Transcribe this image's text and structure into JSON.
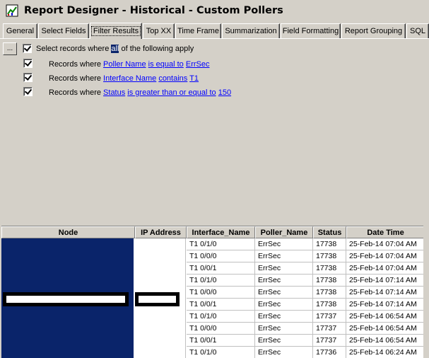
{
  "window": {
    "title": "Report Designer - Historical - Custom Pollers"
  },
  "tabs": [
    {
      "label": "General"
    },
    {
      "label": "Select Fields"
    },
    {
      "label": "Filter Results"
    },
    {
      "label": "Top XX"
    },
    {
      "label": "Time Frame"
    },
    {
      "label": "Summarization"
    },
    {
      "label": "Field Formatting"
    },
    {
      "label": "Report Grouping"
    },
    {
      "label": "SQL"
    }
  ],
  "active_tab": "Filter Results",
  "filter": {
    "more_button": "...",
    "header": {
      "prefix": "Select records where ",
      "quantifier": "all",
      "suffix": " of the following apply",
      "checked": true
    },
    "rules": [
      {
        "prefix": "Records where ",
        "field": "Poller Name",
        "operator": "is equal to",
        "value": "ErrSec",
        "checked": true
      },
      {
        "prefix": "Records where ",
        "field": "Interface Name",
        "operator": "contains",
        "value": "T1",
        "checked": true
      },
      {
        "prefix": "Records where ",
        "field": "Status",
        "operator": "is greater than or equal to",
        "value": "150",
        "checked": true
      }
    ]
  },
  "grid": {
    "columns": [
      "Node",
      "IP Address",
      "Interface_Name",
      "Poller_Name",
      "Status",
      "Date Time"
    ],
    "rows": [
      {
        "interface": "T1 0/1/0",
        "poller": "ErrSec",
        "status": "17738",
        "datetime": "25-Feb-14 07:04 AM"
      },
      {
        "interface": "T1 0/0/0",
        "poller": "ErrSec",
        "status": "17738",
        "datetime": "25-Feb-14 07:04 AM"
      },
      {
        "interface": "T1 0/0/1",
        "poller": "ErrSec",
        "status": "17738",
        "datetime": "25-Feb-14 07:04 AM"
      },
      {
        "interface": "T1 0/1/0",
        "poller": "ErrSec",
        "status": "17738",
        "datetime": "25-Feb-14 07:14 AM"
      },
      {
        "interface": "T1 0/0/0",
        "poller": "ErrSec",
        "status": "17738",
        "datetime": "25-Feb-14 07:14 AM"
      },
      {
        "interface": "T1 0/0/1",
        "poller": "ErrSec",
        "status": "17738",
        "datetime": "25-Feb-14 07:14 AM"
      },
      {
        "interface": "T1 0/1/0",
        "poller": "ErrSec",
        "status": "17737",
        "datetime": "25-Feb-14 06:54 AM"
      },
      {
        "interface": "T1 0/0/0",
        "poller": "ErrSec",
        "status": "17737",
        "datetime": "25-Feb-14 06:54 AM"
      },
      {
        "interface": "T1 0/0/1",
        "poller": "ErrSec",
        "status": "17737",
        "datetime": "25-Feb-14 06:54 AM"
      },
      {
        "interface": "T1 0/1/0",
        "poller": "ErrSec",
        "status": "17736",
        "datetime": "25-Feb-14 06:24 AM"
      }
    ]
  },
  "colors": {
    "selection": "#0a246a",
    "link": "#0000ff",
    "face": "#d4d0c8"
  }
}
